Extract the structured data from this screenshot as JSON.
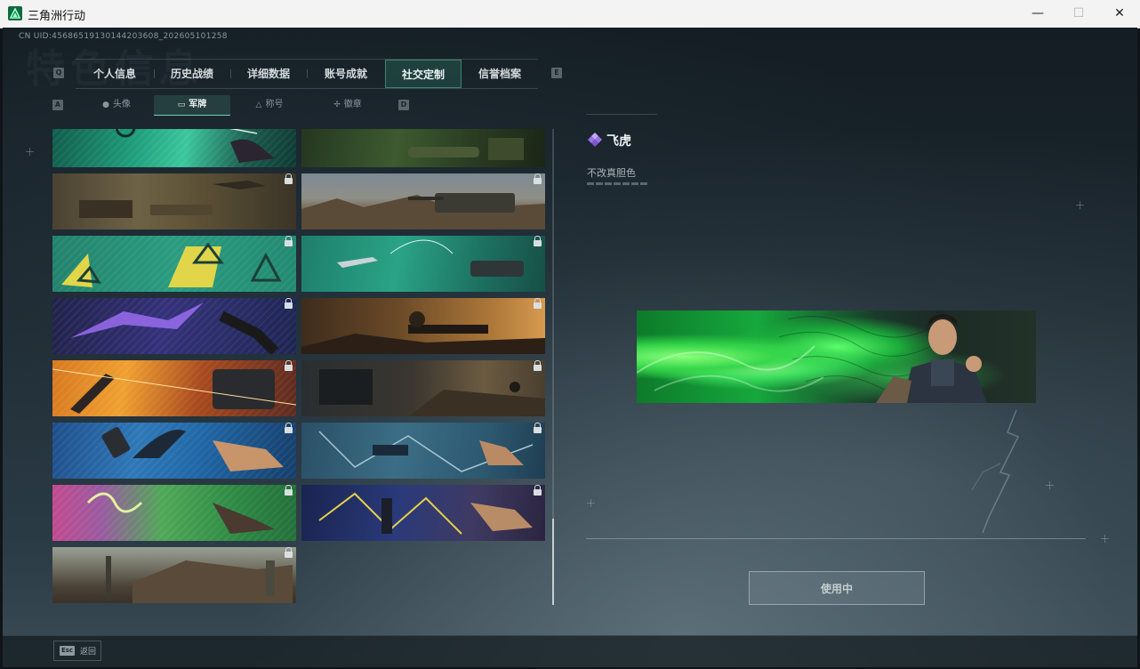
{
  "window": {
    "title": "三角洲行动",
    "minimize": "—",
    "maximize": "☐",
    "close": "✕"
  },
  "uid": "CN UID:45686519130144203608_202605101258",
  "background_title": "特色信息",
  "tabs": {
    "left_key": "Q",
    "right_key": "E",
    "items": [
      {
        "label": "个人信息"
      },
      {
        "label": "历史战绩"
      },
      {
        "label": "详细数据"
      },
      {
        "label": "账号成就"
      },
      {
        "label": "社交定制",
        "active": true
      },
      {
        "label": "信誉档案"
      }
    ]
  },
  "subtabs": {
    "left_key": "A",
    "right_key": "D",
    "items": [
      {
        "label": "头像",
        "icon": "person-icon"
      },
      {
        "label": "军牌",
        "icon": "dogtag-icon",
        "active": true
      },
      {
        "label": "称号",
        "icon": "title-icon"
      },
      {
        "label": "徽章",
        "icon": "badge-icon"
      }
    ]
  },
  "cards": [
    {
      "name": "card-1",
      "locked": false,
      "theme": "teal-hand"
    },
    {
      "name": "card-2",
      "locked": false,
      "theme": "green-field"
    },
    {
      "name": "card-3",
      "locked": true,
      "theme": "desert-soldier"
    },
    {
      "name": "card-4",
      "locked": true,
      "theme": "desert-tank"
    },
    {
      "name": "card-5",
      "locked": true,
      "theme": "teal-triangles"
    },
    {
      "name": "card-6",
      "locked": true,
      "theme": "teal-gun"
    },
    {
      "name": "card-7",
      "locked": true,
      "theme": "purple-lightning"
    },
    {
      "name": "card-8",
      "locked": true,
      "theme": "orange-soldier"
    },
    {
      "name": "card-9",
      "locked": true,
      "theme": "orange-burst"
    },
    {
      "name": "card-10",
      "locked": true,
      "theme": "dark-interior"
    },
    {
      "name": "card-11",
      "locked": true,
      "theme": "blue-wave"
    },
    {
      "name": "card-12",
      "locked": true,
      "theme": "blue-drone"
    },
    {
      "name": "card-13",
      "locked": true,
      "theme": "pink-green"
    },
    {
      "name": "card-14",
      "locked": true,
      "theme": "navy-yellow"
    },
    {
      "name": "card-15",
      "locked": true,
      "theme": "ruins"
    }
  ],
  "detail": {
    "name": "飞虎",
    "subtitle": "不改真胆色",
    "rarity_color": "#b28cf0"
  },
  "use_button": "使用中",
  "footer": {
    "esc_key": "Esc",
    "esc_label": "返回"
  }
}
